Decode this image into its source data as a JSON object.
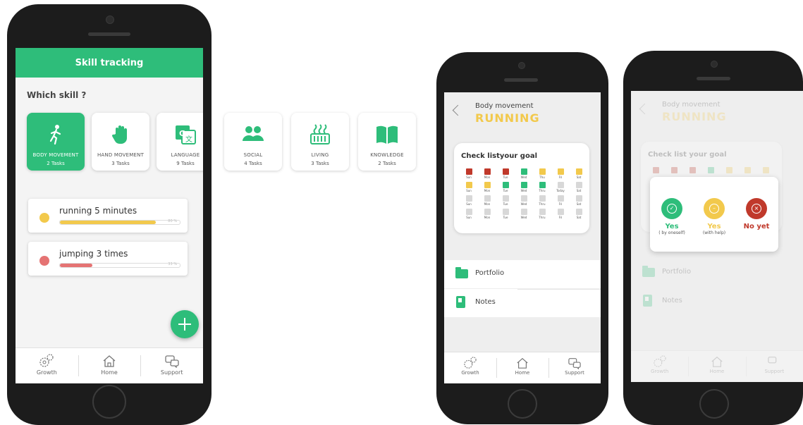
{
  "screen1": {
    "header_title": "Skill tracking",
    "prompt": "Which skill ?",
    "skills": [
      {
        "name": "BODY MOVEMENT",
        "count": "2 Tasks",
        "icon": "running-person-icon"
      },
      {
        "name": "HAND MOVEMENT",
        "count": "3 Tasks",
        "icon": "hand-icon"
      },
      {
        "name": "LANGUAGE",
        "count": "9 Tasks",
        "icon": "translate-icon"
      },
      {
        "name": "SOCIAL",
        "count": "4 Tasks",
        "icon": "people-icon"
      },
      {
        "name": "LIVING",
        "count": "3 Tasks",
        "icon": "heater-icon"
      },
      {
        "name": "KNOWLEDGE",
        "count": "2 Tasks",
        "icon": "book-icon"
      }
    ],
    "tasks": [
      {
        "title": "running 5 minutes",
        "progress": 0.8,
        "pct_label": "80 %",
        "color": "#f2c94c",
        "bar_color": "#f2c94c"
      },
      {
        "title": "jumping 3 times",
        "progress": 0.27,
        "pct_label": "33 %",
        "color": "#e57373",
        "bar_color": "#e57373"
      }
    ],
    "nav": [
      {
        "label": "Growth",
        "icon": "gears-icon"
      },
      {
        "label": "Home",
        "icon": "home-icon"
      },
      {
        "label": "Support",
        "icon": "chat-icon"
      }
    ]
  },
  "screen2": {
    "category": "Body movement",
    "title": "RUNNING",
    "card_title": "Check listyour goal",
    "grid": [
      [
        {
          "d": "Sun",
          "c": "#c0392b"
        },
        {
          "d": "Mon",
          "c": "#c0392b"
        },
        {
          "d": "Tue",
          "c": "#c0392b"
        },
        {
          "d": "Wed",
          "c": "#2ebd7a"
        },
        {
          "d": "Thu",
          "c": "#f2c94c"
        },
        {
          "d": "Fri",
          "c": "#f2c94c"
        },
        {
          "d": "Sat",
          "c": "#f2c94c"
        }
      ],
      [
        {
          "d": "Sun",
          "c": "#f2c94c"
        },
        {
          "d": "Mon",
          "c": "#f2c94c"
        },
        {
          "d": "Tue",
          "c": "#2ebd7a"
        },
        {
          "d": "Wed",
          "c": "#2ebd7a"
        },
        {
          "d": "Thru",
          "c": "#2ebd7a"
        },
        {
          "d": "Today",
          "c": "#d8d8d8"
        },
        {
          "d": "Sat",
          "c": "#d8d8d8"
        }
      ],
      [
        {
          "d": "Sun",
          "c": "#d8d8d8"
        },
        {
          "d": "Mon",
          "c": "#d8d8d8"
        },
        {
          "d": "Tue",
          "c": "#d8d8d8"
        },
        {
          "d": "Wed",
          "c": "#d8d8d8"
        },
        {
          "d": "Thru",
          "c": "#d8d8d8"
        },
        {
          "d": "Fri",
          "c": "#d8d8d8"
        },
        {
          "d": "Sat",
          "c": "#d8d8d8"
        }
      ],
      [
        {
          "d": "Sun",
          "c": "#d8d8d8"
        },
        {
          "d": "Mon",
          "c": "#d8d8d8"
        },
        {
          "d": "Tue",
          "c": "#d8d8d8"
        },
        {
          "d": "Wed",
          "c": "#d8d8d8"
        },
        {
          "d": "Thru",
          "c": "#d8d8d8"
        },
        {
          "d": "Fri",
          "c": "#d8d8d8"
        },
        {
          "d": "Sat",
          "c": "#d8d8d8"
        }
      ]
    ],
    "portfolio_label": "Portfolio",
    "notes_label": "Notes",
    "nav": [
      {
        "label": "Growth",
        "icon": "gears-icon"
      },
      {
        "label": "Home",
        "icon": "home-icon"
      },
      {
        "label": "Support",
        "icon": "chat-icon"
      }
    ]
  },
  "screen3": {
    "category": "Body movement",
    "title": "RUNNING",
    "card_title": "Check list your goal",
    "portfolio_label": "Portfolio",
    "notes_label": "Notes",
    "options": [
      {
        "label": "Yes",
        "sub": "( by oneself)",
        "color": "#2ebd7a",
        "text_color": "#2ebd7a",
        "icon": "check-circle-icon"
      },
      {
        "label": "Yes",
        "sub": "(with help)",
        "color": "#f2c94c",
        "text_color": "#f2c94c",
        "icon": "minus-circle-icon"
      },
      {
        "label": "No yet",
        "sub": "",
        "color": "#c0392b",
        "text_color": "#c0392b",
        "icon": "x-circle-icon"
      }
    ],
    "nav": [
      {
        "label": "Growth",
        "icon": "gears-icon"
      },
      {
        "label": "Home",
        "icon": "home-icon"
      },
      {
        "label": "Support",
        "icon": "chat-icon"
      }
    ]
  },
  "colors": {
    "accent": "#2ebd7a",
    "title_yellow": "#f2c94c",
    "phone_body": "#1c1c1c"
  }
}
